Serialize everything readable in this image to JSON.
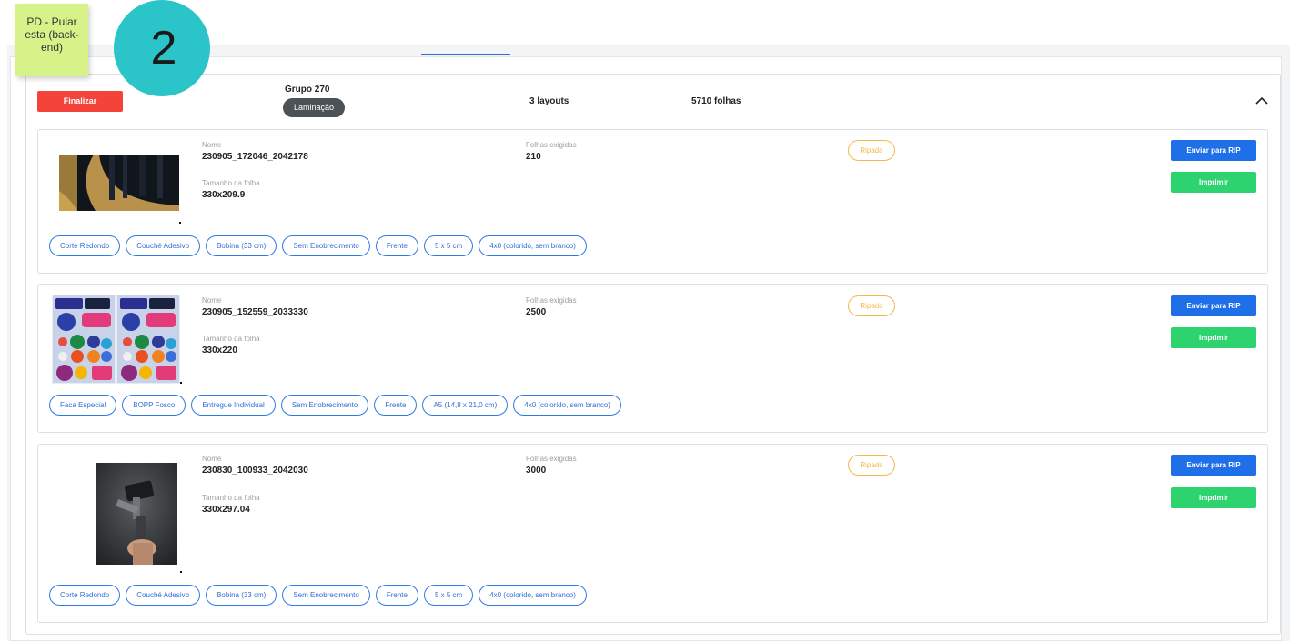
{
  "annotations": {
    "sticky_note": "PD - Pular esta (back-end)",
    "step_number": "2"
  },
  "group": {
    "finalize_label": "Finalizar",
    "title": "Grupo 270",
    "process_badge": "Laminação",
    "layouts": "3 layouts",
    "sheets": "5710 folhas",
    "collapse_icon": "chevron-up-icon"
  },
  "colors": {
    "finalize": "#f4433a",
    "send_rip": "#1f6fe8",
    "print": "#2dd36f",
    "ripado": "#f2b84b",
    "tag_border": "#2f7be6",
    "step_circle": "#2bc4c8",
    "sticky_note": "#d8f28a"
  },
  "labels": {
    "name": "Nome",
    "sheets_required": "Folhas exigidas",
    "sheet_size": "Tamanho da folha"
  },
  "items": [
    {
      "name": "230905_172046_2042178",
      "sheets_required": "210",
      "sheet_size": "330x209.9",
      "status": "Ripado",
      "send_rip_label": "Enviar para RIP",
      "print_label": "Imprimir",
      "thumbnail": "dark-gold-label-image",
      "tags": [
        "Corte Redondo",
        "Couché Adesivo",
        "Bobina (33 cm)",
        "Sem Enobrecimento",
        "Frente",
        "5 x 5 cm",
        "4x0 (colorido, sem branco)"
      ]
    },
    {
      "name": "230905_152559_2033330",
      "sheets_required": "2500",
      "sheet_size": "330x220",
      "status": "Ripado",
      "send_rip_label": "Enviar para RIP",
      "print_label": "Imprimir",
      "thumbnail": "sticker-sheet-image",
      "tags": [
        "Faca Especial",
        "BOPP Fosco",
        "Entregue Individual",
        "Sem Enobrecimento",
        "Frente",
        "A5 (14,8 x 21,0 cm)",
        "4x0 (colorido, sem branco)"
      ]
    },
    {
      "name": "230830_100933_2042030",
      "sheets_required": "3000",
      "sheet_size": "330x297.04",
      "status": "Ripado",
      "send_rip_label": "Enviar para RIP",
      "print_label": "Imprimir",
      "thumbnail": "gimbal-photo-image",
      "tags": [
        "Corte Redondo",
        "Couché Adesivo",
        "Bobina (33 cm)",
        "Sem Enobrecimento",
        "Frente",
        "5 x 5 cm",
        "4x0 (colorido, sem branco)"
      ]
    }
  ]
}
